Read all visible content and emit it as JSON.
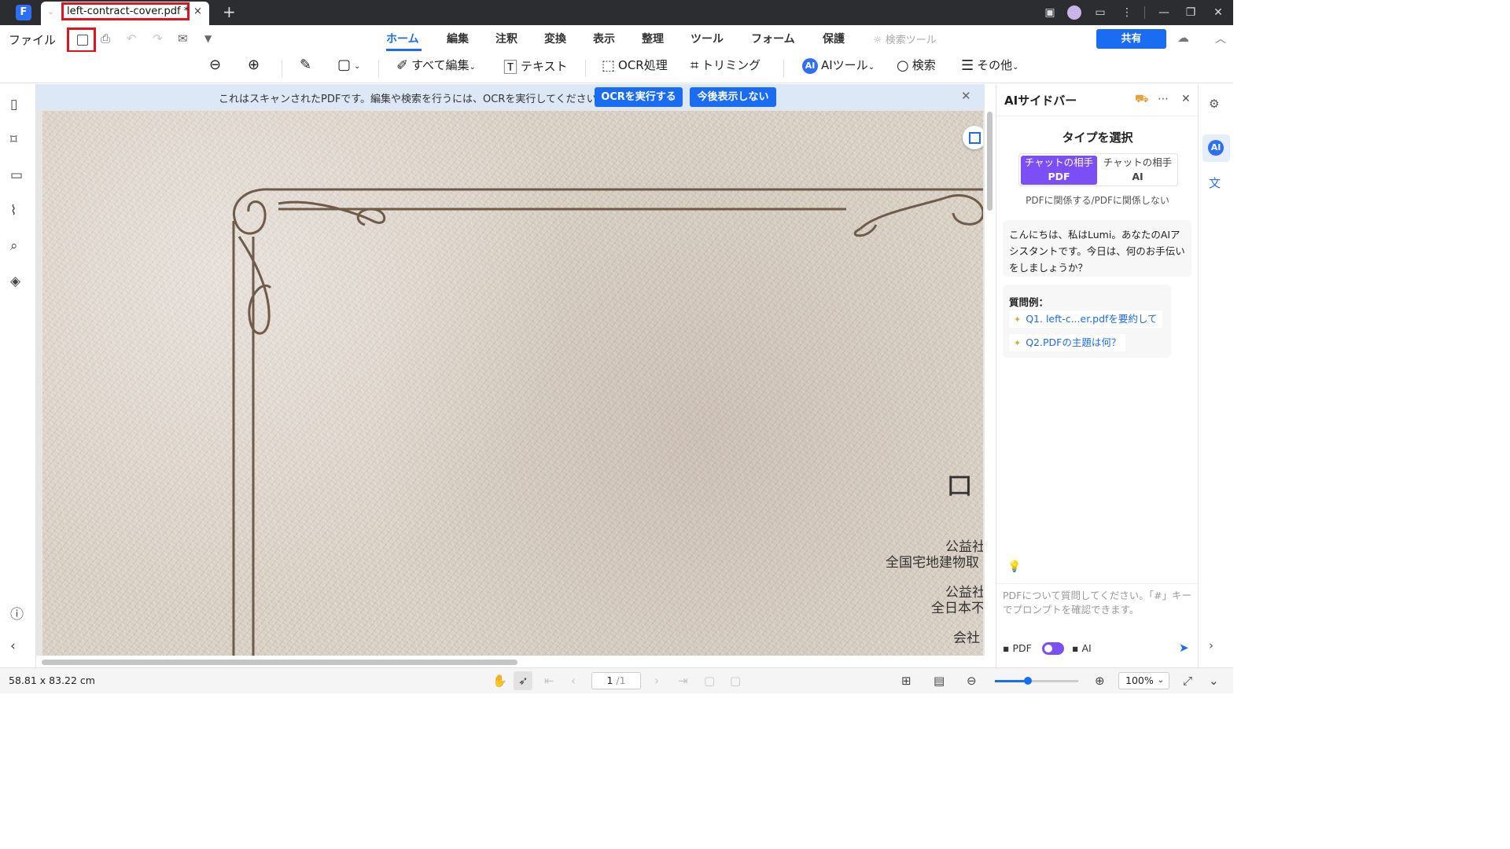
{
  "titlebar": {
    "tab_name": "left-contract-cover.pdf *",
    "close_glyph": "×",
    "add_glyph": "+"
  },
  "menu": {
    "file": "ファイル",
    "tabs": [
      "ホーム",
      "編集",
      "注釈",
      "変換",
      "表示",
      "整理",
      "ツール",
      "フォーム",
      "保護"
    ],
    "active_tab": "ホーム",
    "search_tool": "検索ツール",
    "share": "共有"
  },
  "toolbar": {
    "edit_all": "すべて編集",
    "text": "テキスト",
    "ocr": "OCR処理",
    "trim": "トリミング",
    "ai_tools": "AIツール",
    "search": "検索",
    "more": "その他"
  },
  "banner": {
    "message": "これはスキャンされたPDFです。編集や検索を行うには、OCRを実行してください。",
    "ocr_button": "OCRを実行する",
    "dismiss_button": "今後表示しない"
  },
  "document": {
    "text_lines": [
      "ロ",
      "公益社",
      "全国宅地建物取",
      "公益社",
      "全日本不",
      "会社"
    ]
  },
  "ai_sidebar": {
    "title": "AIサイドバー",
    "type_heading": "タイプを選択",
    "seg_pdf_line1": "チャットの相手",
    "seg_pdf_line2": "PDF",
    "seg_ai_line1": "チャットの相手",
    "seg_ai_line2": "AI",
    "subtitle": "PDFに関係する/PDFに関係しない",
    "greeting": "こんにちは、私はLumi。あなたのAIアシスタントです。今日は、何のお手伝いをしましょうか？",
    "examples_title": "質問例：",
    "examples": [
      "Q1. left-c...er.pdfを要約して",
      "Q2.PDFの主題は何？"
    ],
    "input_placeholder": "PDFについて質問してください。「#」キーでプロンプトを確認できます。",
    "footer_pdf": "PDF",
    "footer_ai": "AI"
  },
  "statusbar": {
    "dimensions": "58.81 x 83.22 cm",
    "page_current": "1",
    "page_total": "/1",
    "zoom": "100%",
    "zoom_fraction": 0.4
  },
  "colors": {
    "accent": "#1a6cf2",
    "ai_purple": "#7b4ff5",
    "highlight_red": "#e0141e",
    "frame_brown": "#6e5b4a"
  }
}
